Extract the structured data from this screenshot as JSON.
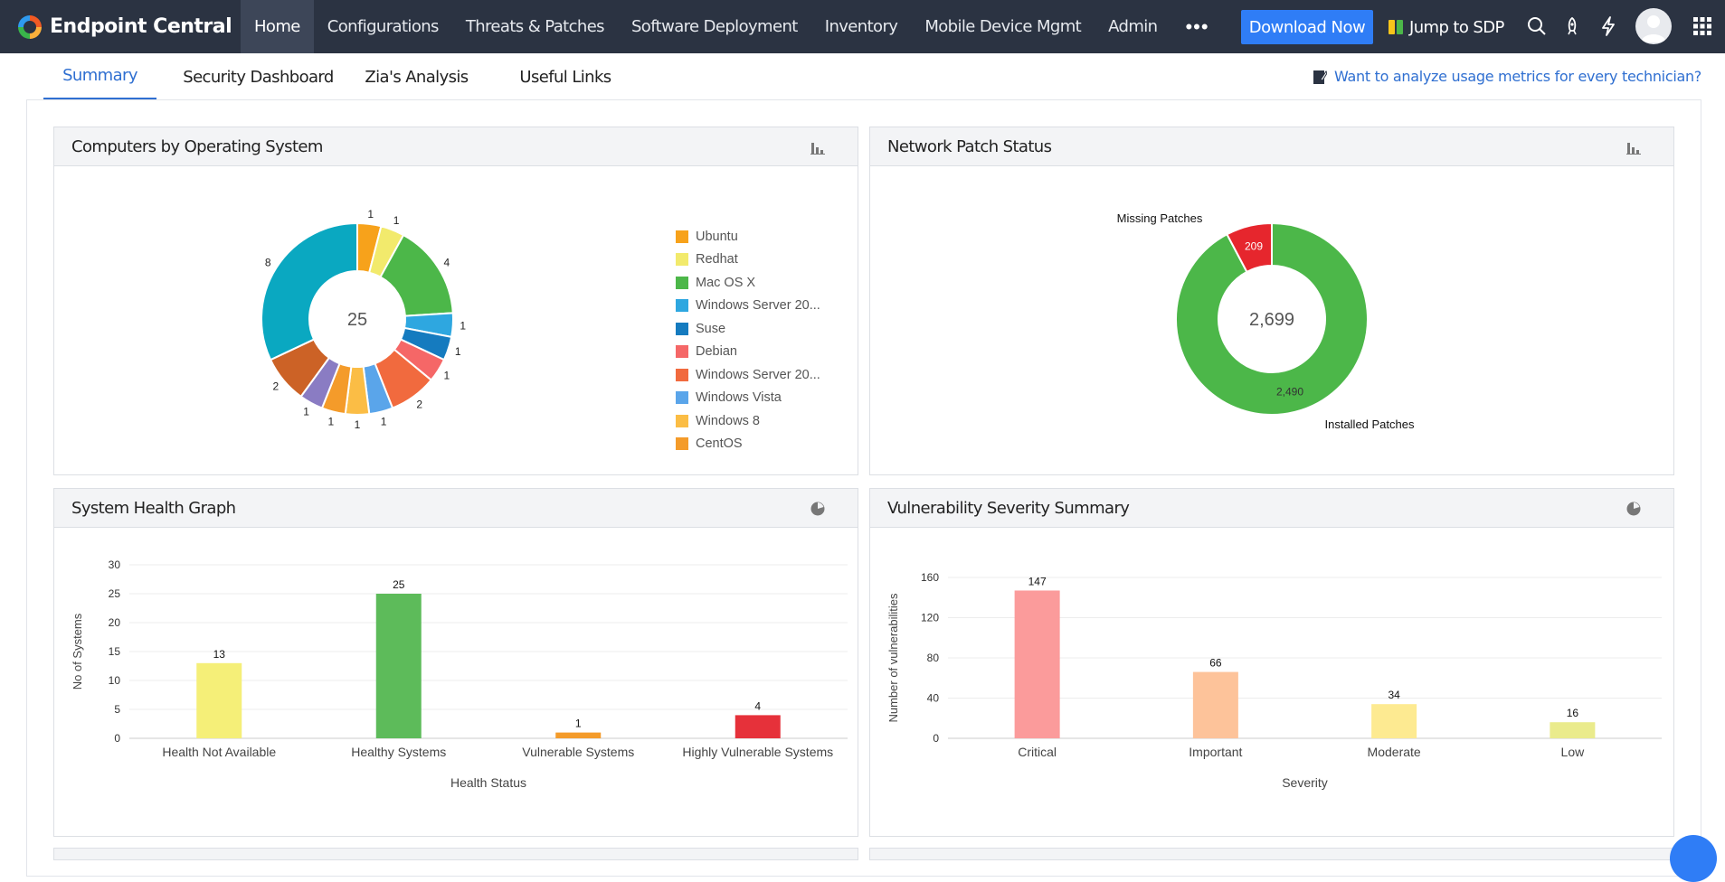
{
  "app": {
    "brand": "Endpoint Central",
    "nav": [
      "Home",
      "Configurations",
      "Threats & Patches",
      "Software Deployment",
      "Inventory",
      "Mobile Device Mgmt",
      "Admin"
    ],
    "more_label": "•••",
    "download_label": "Download Now",
    "jump_label": "Jump to SDP",
    "accent": "#2f7df6"
  },
  "subnav": {
    "tabs": [
      "Summary",
      "Security Dashboard",
      "Zia's Analysis",
      "Useful Links"
    ],
    "active": "Summary",
    "analyze_link": "Want to analyze usage metrics for every technician?"
  },
  "panels": {
    "os": {
      "title": "Computers by Operating System",
      "icon": "bar-chart-icon"
    },
    "patch": {
      "title": "Network Patch Status",
      "icon": "bar-chart-icon"
    },
    "health": {
      "title": "System Health Graph",
      "icon": "pie-chart-icon"
    },
    "vuln": {
      "title": "Vulnerability Severity Summary",
      "icon": "pie-chart-icon"
    }
  },
  "chart_data": [
    {
      "type": "pie",
      "variant": "donut",
      "center_label": "25",
      "slices": [
        {
          "label": "Ubuntu",
          "value": 1,
          "color": "#f7a21b"
        },
        {
          "label": "Redhat",
          "value": 1,
          "color": "#f2ea6c"
        },
        {
          "label": "Mac OS X",
          "value": 4,
          "color": "#4cb749"
        },
        {
          "label": "Windows Server 20...",
          "value": 1,
          "color": "#2ea7e0"
        },
        {
          "label": "Suse",
          "value": 1,
          "color": "#157bbf"
        },
        {
          "label": "Debian",
          "value": 1,
          "color": "#f56767"
        },
        {
          "label": "Windows Server 20...",
          "value": 2,
          "color": "#f16a3e"
        },
        {
          "label": "Windows Vista",
          "value": 1,
          "color": "#5aa5ea"
        },
        {
          "label": "Windows 8",
          "value": 1,
          "color": "#fbbd45"
        },
        {
          "label": "CentOS",
          "value": 1,
          "color": "#f49b2a"
        },
        {
          "label": "",
          "value": 1,
          "color": "#8a7cc3"
        },
        {
          "label": "",
          "value": 2,
          "color": "#cc6226"
        },
        {
          "label": "",
          "value": 8,
          "color": "#0aa8c1"
        }
      ]
    },
    {
      "type": "pie",
      "variant": "donut",
      "center_label": "2,699",
      "slices": [
        {
          "label": "Installed Patches",
          "value": 2490,
          "display": "2,490",
          "color": "#4cb749"
        },
        {
          "label": "Missing Patches",
          "value": 209,
          "display": "209",
          "color": "#e6262d"
        }
      ]
    },
    {
      "type": "bar",
      "categories": [
        "Health Not Available",
        "Healthy Systems",
        "Vulnerable Systems",
        "Highly Vulnerable Systems"
      ],
      "values": [
        13,
        25,
        1,
        4
      ],
      "colors": [
        "#f5ef78",
        "#5dbb5a",
        "#f49b2a",
        "#e6313a"
      ],
      "xlabel": "Health Status",
      "ylabel": "No of Systems",
      "ylim": [
        0,
        30
      ],
      "yticks": [
        0,
        5,
        10,
        15,
        20,
        25,
        30
      ],
      "grid": true
    },
    {
      "type": "bar",
      "categories": [
        "Critical",
        "Important",
        "Moderate",
        "Low"
      ],
      "values": [
        147,
        66,
        34,
        16
      ],
      "colors": [
        "#fb9b9b",
        "#fdc39a",
        "#fdea91",
        "#eaeb8c"
      ],
      "xlabel": "Severity",
      "ylabel": "Number of vulnerabilities",
      "ylim": [
        0,
        160
      ],
      "yticks": [
        0,
        40,
        80,
        120,
        160
      ],
      "grid": true
    }
  ]
}
